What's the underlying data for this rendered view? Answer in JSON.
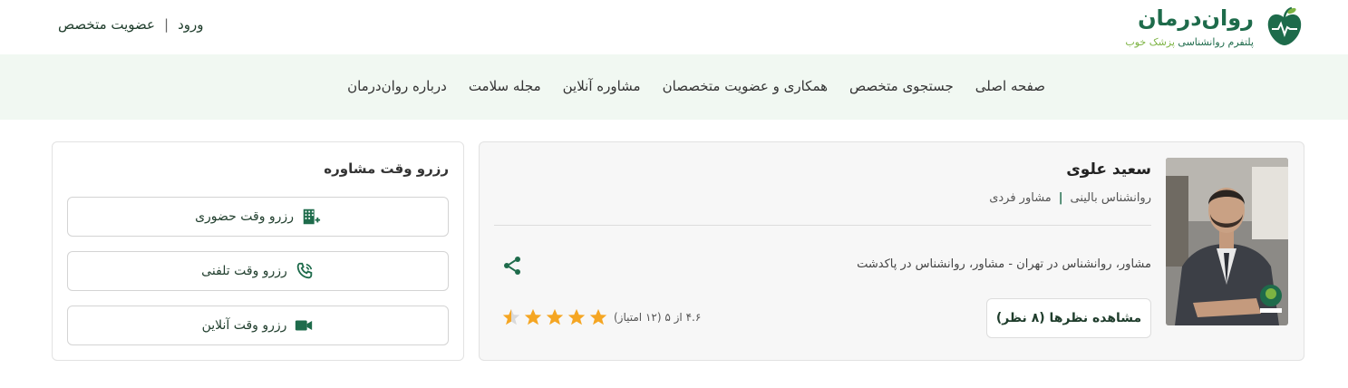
{
  "header": {
    "login_label": "ورود",
    "membership_label": "عضویت متخصص",
    "logo_title": "روان‌درمان",
    "logo_subtitle": "پلتفرم روانشناسی",
    "logo_subtitle_accent": "پزشک خوب"
  },
  "nav": {
    "items": [
      "صفحه اصلی",
      "جستجوی متخصص",
      "همکاری و عضویت متخصصان",
      "مشاوره آنلاین",
      "مجله سلامت",
      "درباره روان‌درمان"
    ]
  },
  "profile": {
    "name": "سعید علوی",
    "role1": "مشاور فردی",
    "role2": "روانشناس بالینی",
    "description": "مشاور، روانشناس در تهران - مشاور، روانشناس در پاکدشت",
    "reviews_button": "مشاهده نظرها (۸ نظر)",
    "rating_text": "۴.۶ از ۵ (۱۲ امتیاز)",
    "rating_value": 4.6,
    "rating_max": 5
  },
  "booking": {
    "title": "رزرو وقت مشاوره",
    "in_person": "رزرو وقت حضوری",
    "phone": "رزرو وقت تلفنی",
    "online": "رزرو وقت آنلاین"
  },
  "colors": {
    "brand": "#1e6b4b",
    "accent": "#7cb342",
    "star": "#f5a623",
    "nav_bg": "#f1f8f2"
  }
}
